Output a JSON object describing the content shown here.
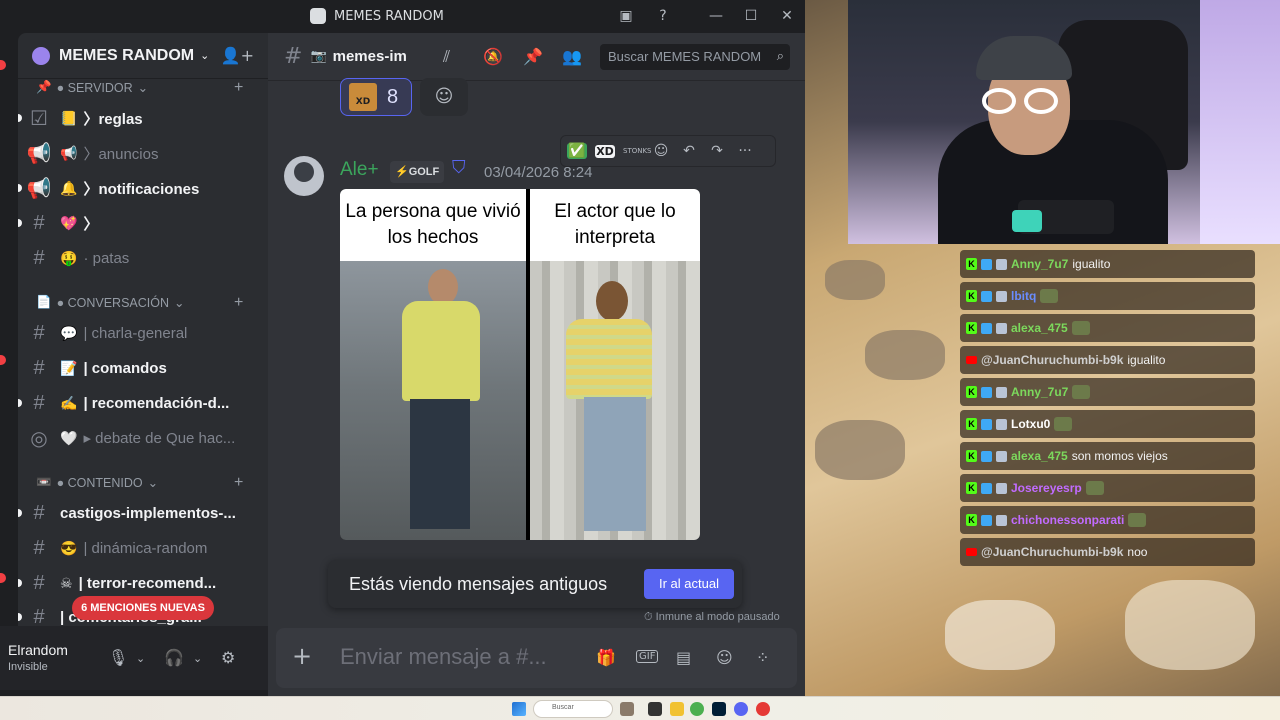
{
  "window": {
    "title": "MEMES RANDOM",
    "controls": [
      "inbox-icon",
      "help-icon",
      "minimize-icon",
      "maximize-icon",
      "close-icon"
    ]
  },
  "server": {
    "name": "MEMES RANDOM",
    "chevron": "⌄",
    "invite_icon": "add-user-icon"
  },
  "categories": [
    {
      "icon": "📌",
      "label": "● SERVIDOR",
      "chevron": "⌄"
    },
    {
      "icon": "📄",
      "label": "● CONVERSACIÓN",
      "chevron": "⌄"
    },
    {
      "icon": "📼",
      "label": "● CONTENIDO",
      "chevron": "⌄"
    }
  ],
  "channels": [
    {
      "icon": "☑",
      "emoji": "📒",
      "label": "〉reglas",
      "state": "unread"
    },
    {
      "icon": "📢",
      "emoji": "📢",
      "label": "〉anuncios",
      "state": "read"
    },
    {
      "icon": "📢",
      "emoji": "🔔",
      "label": "〉notificaciones",
      "state": "unread"
    },
    {
      "icon": "#",
      "emoji": "💖",
      "label": "〉",
      "state": "unread"
    },
    {
      "icon": "#",
      "emoji": "🤑",
      "label": "· patas",
      "state": "read"
    },
    {
      "icon": "#",
      "emoji": "💬",
      "label": "| charla-general",
      "state": "read"
    },
    {
      "icon": "#",
      "emoji": "📝",
      "label": "| comandos",
      "state": "unread"
    },
    {
      "icon": "#",
      "emoji": "✍",
      "label": "| recomendación-d...",
      "state": "unread"
    },
    {
      "icon": "◎",
      "emoji": "🤍",
      "label": "▸ debate de Que hac...",
      "state": "read"
    },
    {
      "icon": "#",
      "emoji": "",
      "label": "castigos-implementos-...",
      "state": "unread"
    },
    {
      "icon": "#",
      "emoji": "😎",
      "label": "| dinámica-random",
      "state": "read"
    },
    {
      "icon": "#",
      "emoji": "☠",
      "label": "| terror-recomend...",
      "state": "unread"
    },
    {
      "icon": "#",
      "emoji": "",
      "label": "| comentarios_gra...",
      "state": "unread"
    }
  ],
  "mentions_banner": "6 MENCIONES NUEVAS",
  "user": {
    "name": "Elrandom",
    "status": "Invisible"
  },
  "channel_header": {
    "name": "memes-im",
    "search_placeholder": "Buscar MEMES RANDOM"
  },
  "reaction": {
    "emoji_text": "XD",
    "count": "8"
  },
  "message": {
    "author": "Ale+",
    "tag": "⚡GOLF",
    "timestamp": "03/04/2026 8:24",
    "toolbar": [
      "✅",
      "XD",
      "STONKS",
      "☺",
      "↶",
      "↷",
      "···"
    ],
    "meme": {
      "left_caption": "La persona que vivió los hechos",
      "right_caption": "El actor que lo interpreta"
    }
  },
  "old_messages": {
    "text": "Estás viendo mensajes antiguos",
    "button": "Ir al actual",
    "note": "Inmune al modo pausado"
  },
  "composer": {
    "placeholder": "Enviar mensaje a #..."
  },
  "stream_chat": [
    {
      "platform": "kick",
      "user": "Anny_7u7",
      "color": "#7cd95c",
      "msg": "igualito"
    },
    {
      "platform": "kick",
      "user": "lbitq",
      "color": "#6a8cff",
      "msg": ""
    },
    {
      "platform": "kick",
      "user": "alexa_475",
      "color": "#7cd95c",
      "msg": ""
    },
    {
      "platform": "youtube",
      "user": "@JuanChuruchumbi-b9k",
      "color": "#cfcfcf",
      "msg": "igualito"
    },
    {
      "platform": "kick",
      "user": "Anny_7u7",
      "color": "#7cd95c",
      "msg": ""
    },
    {
      "platform": "kick",
      "user": "Lotxu0",
      "color": "#ffffff",
      "msg": ""
    },
    {
      "platform": "kick",
      "user": "alexa_475",
      "color": "#7cd95c",
      "msg": "son momos viejos"
    },
    {
      "platform": "kick",
      "user": "Josereyesrp",
      "color": "#c16bff",
      "msg": ""
    },
    {
      "platform": "kick",
      "user": "chichonessonparati",
      "color": "#c16bff",
      "msg": ""
    },
    {
      "platform": "youtube",
      "user": "@JuanChuruchumbi-b9k",
      "color": "#cfcfcf",
      "msg": "noo"
    }
  ],
  "taskbar": {
    "search": "Buscar"
  }
}
